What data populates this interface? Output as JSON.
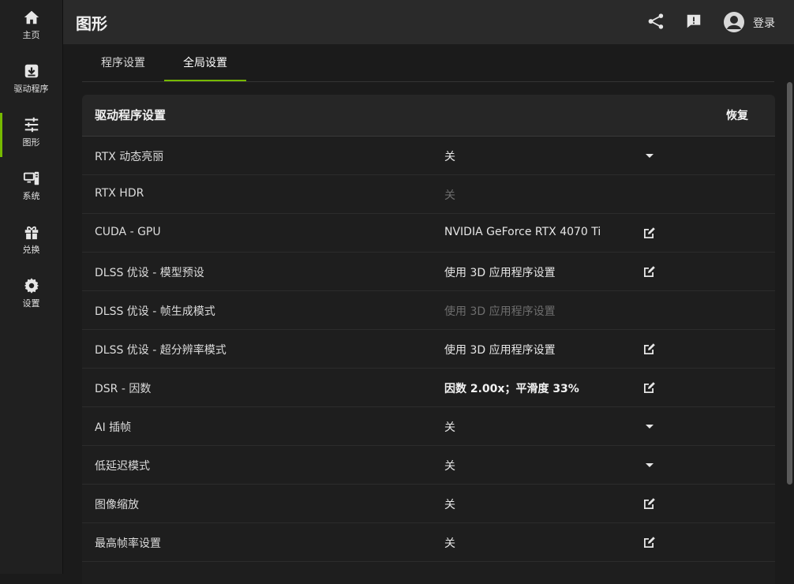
{
  "sidebar": {
    "items": [
      {
        "label": "主页",
        "icon": "home-icon"
      },
      {
        "label": "驱动程序",
        "icon": "driver-download-icon"
      },
      {
        "label": "图形",
        "icon": "sliders-icon",
        "active": true
      },
      {
        "label": "系统",
        "icon": "system-icon"
      },
      {
        "label": "兑换",
        "icon": "gift-icon"
      },
      {
        "label": "设置",
        "icon": "gear-icon"
      }
    ]
  },
  "header": {
    "title": "图形",
    "login_label": "登录",
    "icons": [
      "share-icon",
      "feedback-icon",
      "avatar-icon"
    ]
  },
  "tabs": [
    {
      "label": "程序设置",
      "active": false
    },
    {
      "label": "全局设置",
      "active": true
    }
  ],
  "panel": {
    "title": "驱动程序设置",
    "restore_label": "恢复",
    "rows": [
      {
        "label": "RTX 动态亮丽",
        "value": "关",
        "state": "normal",
        "action": "dropdown"
      },
      {
        "label": "RTX HDR",
        "value": "关",
        "state": "disabled",
        "action": "none"
      },
      {
        "label": "CUDA - GPU",
        "value": "NVIDIA GeForce RTX 4070 Ti",
        "state": "normal",
        "action": "edit"
      },
      {
        "label": "DLSS 优设 - 模型预设",
        "value": "使用 3D 应用程序设置",
        "state": "normal",
        "action": "edit"
      },
      {
        "label": "DLSS 优设 - 帧生成模式",
        "value": "使用 3D 应用程序设置",
        "state": "disabled",
        "action": "none"
      },
      {
        "label": "DLSS 优设 - 超分辨率模式",
        "value": "使用 3D 应用程序设置",
        "state": "normal",
        "action": "edit"
      },
      {
        "label": "DSR - 因数",
        "value": "因数 2.00x；平滑度 33%",
        "state": "bold",
        "action": "edit"
      },
      {
        "label": "AI 插帧",
        "value": "关",
        "state": "normal",
        "action": "dropdown"
      },
      {
        "label": "低延迟模式",
        "value": "关",
        "state": "normal",
        "action": "dropdown"
      },
      {
        "label": "图像缩放",
        "value": "关",
        "state": "normal",
        "action": "edit"
      },
      {
        "label": "最高帧率设置",
        "value": "关",
        "state": "normal",
        "action": "edit"
      }
    ]
  },
  "colors": {
    "accent": "#76b900",
    "background": "#1b1b1b",
    "sidebar": "#202020",
    "topbar": "#2a2a2a",
    "disabled_text": "#6e6e6e"
  }
}
